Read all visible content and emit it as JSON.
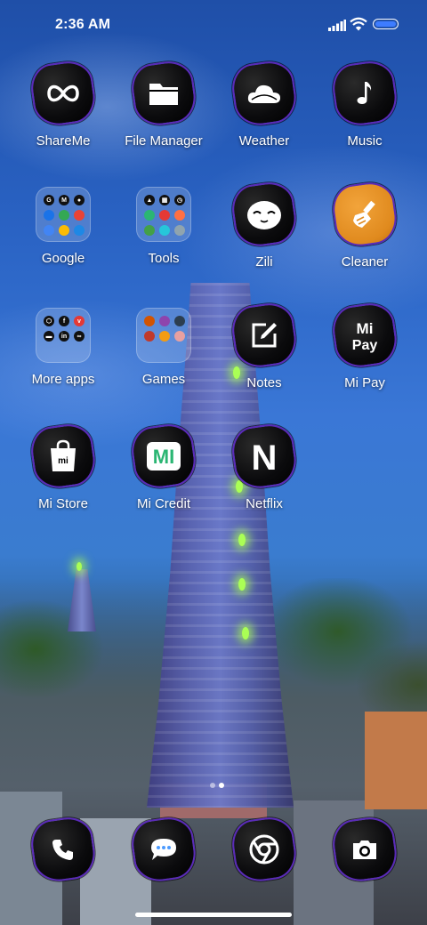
{
  "status_bar": {
    "time": "2:36 AM",
    "signal_icon": "signal-icon",
    "wifi_icon": "wifi-icon",
    "battery_icon": "battery-icon",
    "battery_color": "#3d7cff"
  },
  "apps": [
    {
      "label": "ShareMe",
      "icon": "shareme-icon"
    },
    {
      "label": "File Manager",
      "icon": "folder-icon"
    },
    {
      "label": "Weather",
      "icon": "cloud-icon"
    },
    {
      "label": "Music",
      "icon": "music-note-icon"
    },
    {
      "label": "Google",
      "icon": "google-folder-icon"
    },
    {
      "label": "Tools",
      "icon": "tools-folder-icon"
    },
    {
      "label": "Zili",
      "icon": "zili-face-icon"
    },
    {
      "label": "Cleaner",
      "icon": "broom-icon"
    },
    {
      "label": "More apps",
      "icon": "more-apps-folder-icon"
    },
    {
      "label": "Games",
      "icon": "games-folder-icon"
    },
    {
      "label": "Notes",
      "icon": "notes-pencil-icon"
    },
    {
      "label": "Mi Pay",
      "icon": "mi-pay-icon"
    },
    {
      "label": "Mi Store",
      "icon": "shopping-bag-icon"
    },
    {
      "label": "Mi Credit",
      "icon": "mi-credit-icon"
    },
    {
      "label": "Netflix",
      "icon": "netflix-icon"
    }
  ],
  "icon_text": {
    "mi_pay_line1": "Mi",
    "mi_pay_line2": "Pay",
    "mi_store": "mi",
    "mi_credit": "MI",
    "netflix": "N"
  },
  "dock": [
    {
      "icon": "phone-icon"
    },
    {
      "icon": "messages-icon"
    },
    {
      "icon": "chrome-icon"
    },
    {
      "icon": "camera-icon"
    }
  ],
  "page_indicator": {
    "pages": 2,
    "active": 2
  },
  "theme": {
    "icon_border": "#5a2bb8",
    "icon_background": "#0b0b0d",
    "cleaner_background": "#e08a1e"
  }
}
